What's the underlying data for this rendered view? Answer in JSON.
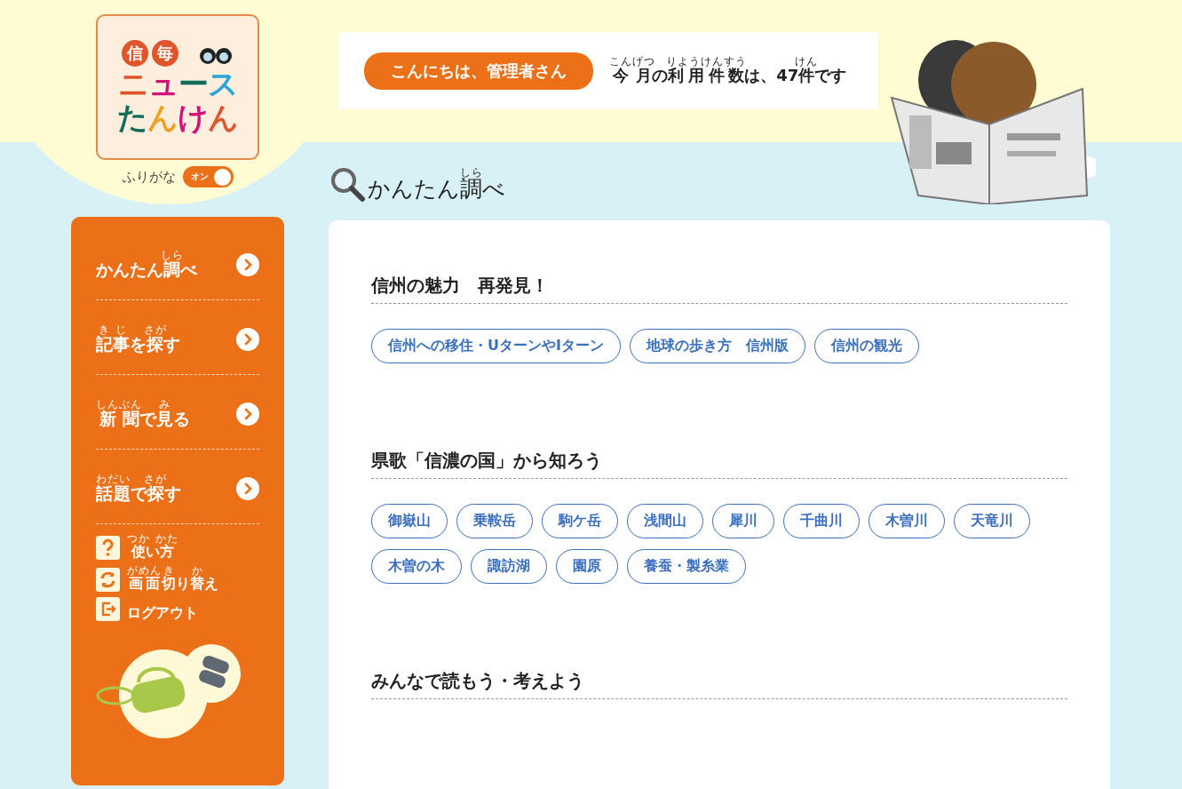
{
  "logo": {
    "badge": [
      "信",
      "毎"
    ],
    "line1": "ニュース",
    "line2": "たんけん"
  },
  "furigana": {
    "label": "ふりがな",
    "toggle_label": "オン",
    "on": true
  },
  "greeting": "こんにちは、管理者さん",
  "usage": [
    {
      "text": "今月",
      "ruby": "こんげつ"
    },
    {
      "text": "の"
    },
    {
      "text": "利用件数",
      "ruby": "りようけんすう"
    },
    {
      "text": "は、47"
    },
    {
      "text": "件",
      "ruby": "けん"
    },
    {
      "text": "です"
    }
  ],
  "page_title": [
    {
      "text": "かんたん"
    },
    {
      "text": "調",
      "ruby": "しら"
    },
    {
      "text": "べ"
    }
  ],
  "sidebar": {
    "nav": [
      {
        "label": [
          {
            "text": "かんたん"
          },
          {
            "text": "調",
            "ruby": "しら"
          },
          {
            "text": "べ"
          }
        ]
      },
      {
        "label": [
          {
            "text": "記事",
            "ruby": "きじ"
          },
          {
            "text": "を"
          },
          {
            "text": "探",
            "ruby": "さが"
          },
          {
            "text": "す"
          }
        ]
      },
      {
        "label": [
          {
            "text": "新聞",
            "ruby": "しんぶん"
          },
          {
            "text": "で"
          },
          {
            "text": "見",
            "ruby": "み"
          },
          {
            "text": "る"
          }
        ]
      },
      {
        "label": [
          {
            "text": "話題",
            "ruby": "わだい"
          },
          {
            "text": "で"
          },
          {
            "text": "探",
            "ruby": "さが"
          },
          {
            "text": "す"
          }
        ]
      }
    ],
    "links": [
      {
        "kind": "help",
        "label": [
          {
            "text": "使",
            "ruby": "つか"
          },
          {
            "text": "い"
          },
          {
            "text": "方",
            "ruby": "かた"
          }
        ]
      },
      {
        "kind": "switch",
        "label": [
          {
            "text": "画面",
            "ruby": "がめん"
          },
          {
            "text": "切",
            "ruby": "き"
          },
          {
            "text": "り"
          },
          {
            "text": "替",
            "ruby": "か"
          },
          {
            "text": "え"
          }
        ]
      },
      {
        "kind": "logout",
        "label": [
          {
            "text": "ログアウト"
          }
        ]
      }
    ]
  },
  "sections": [
    {
      "title": "信州の魅力　再発見！",
      "tags": [
        "信州への移住・UターンやIターン",
        "地球の歩き方　信州版",
        "信州の観光"
      ]
    },
    {
      "title": "県歌「信濃の国」から知ろう",
      "tags": [
        "御嶽山",
        "乗鞍岳",
        "駒ケ岳",
        "浅間山",
        "犀川",
        "千曲川",
        "木曽川",
        "天竜川",
        "木曽の木",
        "諏訪湖",
        "園原",
        "養蚕・製糸業"
      ]
    },
    {
      "title": "みんなで読もう・考えよう"
    }
  ]
}
